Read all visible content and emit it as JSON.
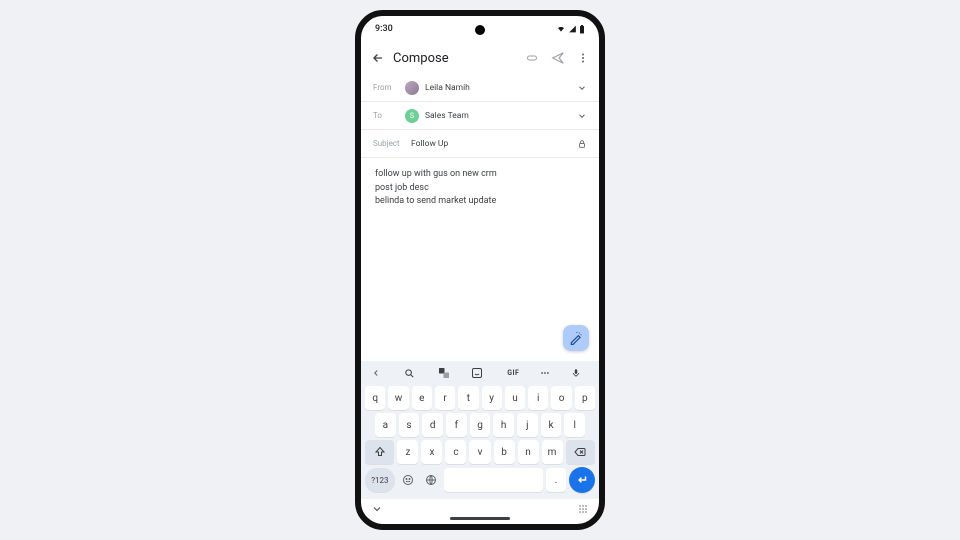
{
  "status": {
    "time": "9:30"
  },
  "appbar": {
    "title": "Compose"
  },
  "from": {
    "label": "From",
    "name": "Leila Namih"
  },
  "to": {
    "label": "To",
    "name": "Sales Team",
    "avatar_letter": "S"
  },
  "subject": {
    "label": "Subject",
    "value": "Follow Up"
  },
  "body": {
    "line1": "follow up with gus on new crm",
    "line2": "post job desc",
    "line3": "belinda to send market update"
  },
  "keyboard": {
    "gif": "GIF",
    "row1": {
      "k0": "q",
      "k1": "w",
      "k2": "e",
      "k3": "r",
      "k4": "t",
      "k5": "y",
      "k6": "u",
      "k7": "i",
      "k8": "o",
      "k9": "p"
    },
    "row2": {
      "k0": "a",
      "k1": "s",
      "k2": "d",
      "k3": "f",
      "k4": "g",
      "k5": "h",
      "k6": "j",
      "k7": "k",
      "k8": "l"
    },
    "row3": {
      "k0": "z",
      "k1": "x",
      "k2": "c",
      "k3": "v",
      "k4": "b",
      "k5": "n",
      "k6": "m"
    },
    "numkey": "?123",
    "period": "."
  }
}
